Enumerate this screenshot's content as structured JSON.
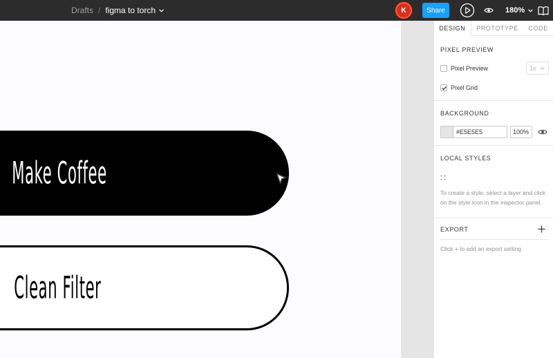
{
  "topbar": {
    "breadcrumb_root": "Drafts",
    "breadcrumb_separator": "/",
    "file_name": "figma to torch",
    "avatar_initial": "K",
    "avatar_color": "#d4301e",
    "share_label": "Share",
    "share_color": "#18a0fb",
    "play_icon": "play-icon",
    "view_icon": "eye-icon",
    "zoom_level": "180%",
    "help_icon": "book-icon"
  },
  "canvas": {
    "background": "#fcfbfd",
    "buttons": [
      {
        "label": "Make Coffee",
        "style": "filled",
        "fill": "#000000",
        "text_color": "#ffffff"
      },
      {
        "label": "Clean Filter",
        "style": "outline",
        "fill": "#ffffff",
        "text_color": "#000000"
      }
    ],
    "cursor_icon": "pointer-cursor-icon"
  },
  "panel": {
    "tabs": [
      {
        "label": "DESIGN",
        "active": true
      },
      {
        "label": "PROTOTYPE",
        "active": false
      },
      {
        "label": "CODE",
        "active": false
      }
    ],
    "pixel_preview": {
      "title": "PIXEL PREVIEW",
      "pixel_preview_label": "Pixel Preview",
      "pixel_preview_checked": false,
      "scale_value": "1x",
      "pixel_grid_label": "Pixel Grid",
      "pixel_grid_checked": true
    },
    "background": {
      "title": "BACKGROUND",
      "color": "#E5E5E5",
      "hex_value": "#E5E5E5",
      "opacity": "100%",
      "visibility_icon": "eye-icon"
    },
    "local_styles": {
      "title": "LOCAL STYLES",
      "icon": "style-grid-icon",
      "help_text": "To create a style, select a layer and click on the style icon in the inspector panel."
    },
    "export": {
      "title": "EXPORT",
      "add_icon": "plus-icon",
      "help_text": "Click + to add an export setting"
    }
  }
}
